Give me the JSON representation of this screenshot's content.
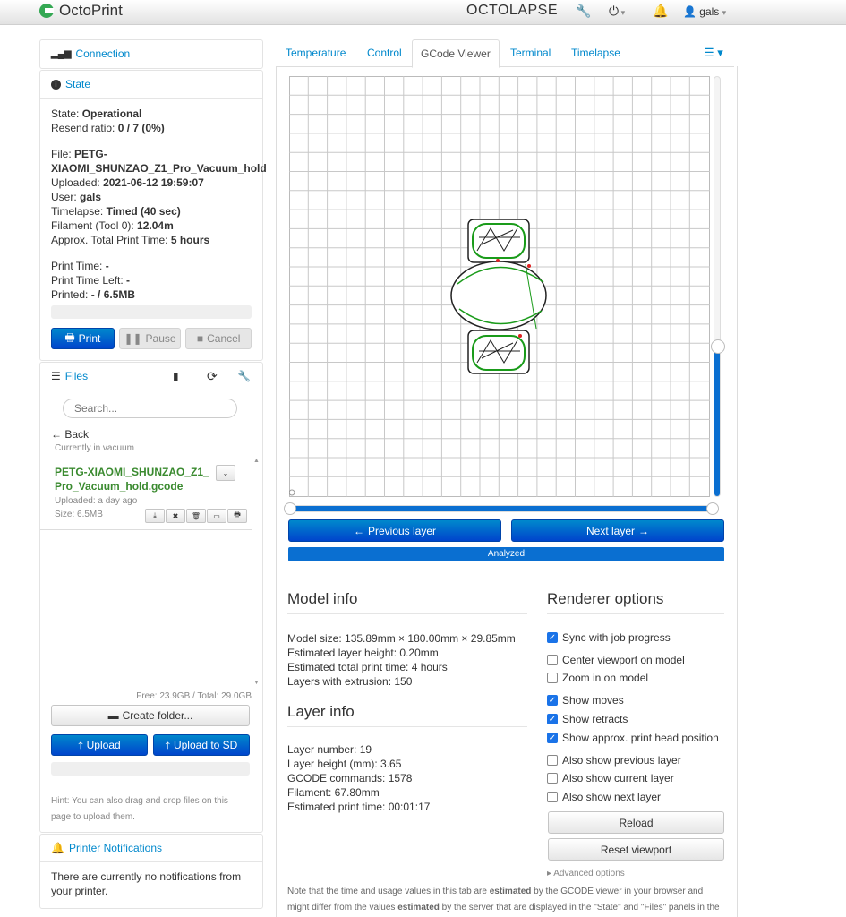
{
  "navbar": {
    "brand": "OctoPrint",
    "octolapse": "OCTOLAPSE",
    "user": "gals"
  },
  "connection": {
    "title": "Connection"
  },
  "state": {
    "title": "State",
    "state_label": "State:",
    "state_value": "Operational",
    "resend_label": "Resend ratio:",
    "resend_value": "0 / 7 (0%)",
    "file_label": "File:",
    "file_value_1": "PETG-",
    "file_value_2": "XIAOMI_SHUNZAO_Z1_Pro_Vacuum_hold",
    "uploaded_label": "Uploaded:",
    "uploaded_value": "2021-06-12 19:59:07",
    "user_label": "User:",
    "user_value": "gals",
    "timelapse_label": "Timelapse:",
    "timelapse_value": "Timed (40 sec)",
    "filament_label": "Filament (Tool 0):",
    "filament_value": "12.04m",
    "approx_label": "Approx. Total Print Time:",
    "approx_value": "5 hours",
    "print_time_label": "Print Time:",
    "print_time_value": "-",
    "print_left_label": "Print Time Left:",
    "print_left_value": "-",
    "printed_label": "Printed:",
    "printed_value": "- / 6.5MB",
    "print_btn": "Print",
    "pause_btn": "Pause",
    "cancel_btn": "Cancel"
  },
  "files": {
    "title": "Files",
    "search_placeholder": "Search...",
    "back": "Back",
    "current": "Currently in vacuum",
    "file_name": "PETG-XIAOMI_SHUNZAO_Z1_ Pro_Vacuum_hold.gcode",
    "file_uploaded": "Uploaded: a day ago",
    "file_size": "Size: 6.5MB",
    "free": "Free: 23.9GB / Total: 29.0GB",
    "create_folder": "Create folder...",
    "upload": "Upload",
    "upload_sd": "Upload to SD",
    "hint": "Hint: You can also drag and drop files on this page to upload them."
  },
  "notifications": {
    "title": "Printer Notifications",
    "text": "There are currently no notifications from your printer."
  },
  "tabs": [
    "Temperature",
    "Control",
    "GCode Viewer",
    "Terminal",
    "Timelapse"
  ],
  "viewer": {
    "prev_layer": "Previous layer",
    "next_layer": "Next layer",
    "analyzed": "Analyzed",
    "layer_slider_fraction": 0.64,
    "command_slider_fraction": 1.0
  },
  "model_info": {
    "title": "Model info",
    "size": "Model size: 135.89mm × 180.00mm × 29.85mm",
    "layer_height": "Estimated layer height: 0.20mm",
    "total_time": "Estimated total print time: 4 hours",
    "layers": "Layers with extrusion: 150"
  },
  "layer_info": {
    "title": "Layer info",
    "number": "Layer number: 19",
    "height": "Layer height (mm): 3.65",
    "gcode": "GCODE commands: 1578",
    "filament": "Filament: 67.80mm",
    "time": "Estimated print time: 00:01:17"
  },
  "renderer": {
    "title": "Renderer options",
    "options": [
      {
        "label": "Sync with job progress",
        "checked": true
      },
      {
        "label": "Center viewport on model",
        "checked": false
      },
      {
        "label": "Zoom in on model",
        "checked": false
      },
      {
        "label": "Show moves",
        "checked": true
      },
      {
        "label": "Show retracts",
        "checked": true
      },
      {
        "label": "Show approx. print head position",
        "checked": true
      },
      {
        "label": "Also show previous layer",
        "checked": false
      },
      {
        "label": "Also show current layer",
        "checked": false
      },
      {
        "label": "Also show next layer",
        "checked": false
      }
    ],
    "reload": "Reload",
    "reset": "Reset viewport",
    "advanced": "Advanced options"
  },
  "note": {
    "p1": "Note that the time and usage values in this tab are ",
    "b1": "estimated",
    "p2": " by the GCODE viewer in your browser and might differ from the values ",
    "b2": "estimated",
    "p3": " by the server that are displayed in the \"State\" and \"Files\" panels in the"
  },
  "colors": {
    "accent": "#0088cc",
    "primary_btn": "#0055cc",
    "bar": "#0a6fd1"
  }
}
